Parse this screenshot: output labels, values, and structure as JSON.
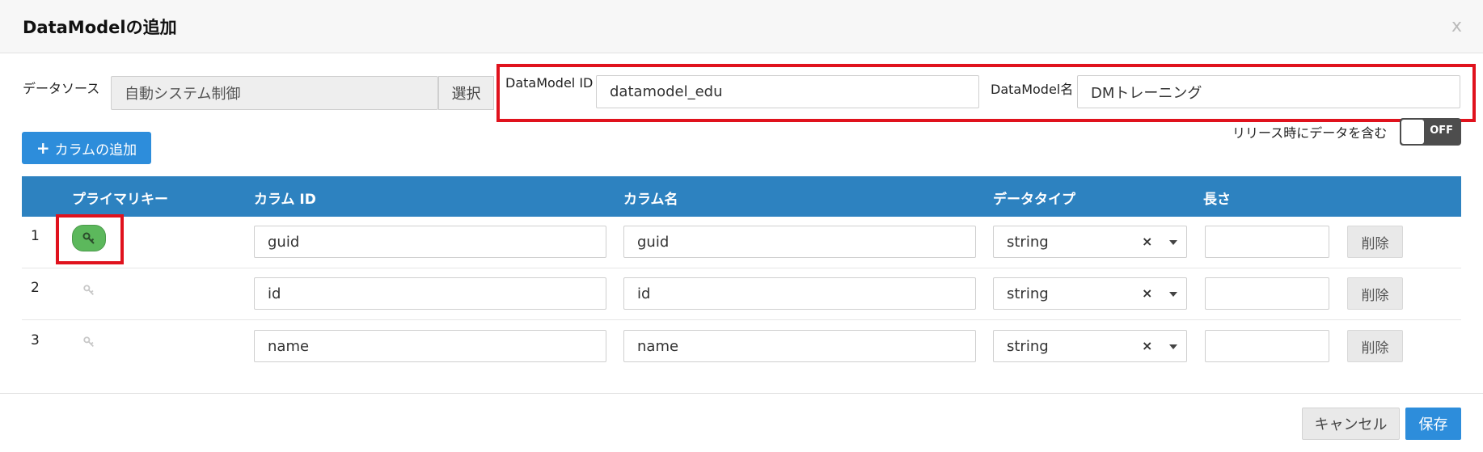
{
  "dialog": {
    "title": "DataModelの追加",
    "close_label": "x"
  },
  "datasource": {
    "label": "データソース",
    "value": "自動システム制御",
    "select_label": "選択"
  },
  "datamodel_id": {
    "label": "DataModel ID",
    "value": "datamodel_edu"
  },
  "datamodel_name": {
    "label": "DataModel名",
    "value": "DMトレーニング"
  },
  "add_column_button": {
    "icon": "plus-icon",
    "label": "カラムの追加"
  },
  "release_toggle": {
    "label": "リリース時にデータを含む",
    "state": "OFF"
  },
  "table": {
    "headers": {
      "primary_key": "プライマリキー",
      "column_id": "カラム ID",
      "column_name": "カラム名",
      "data_type": "データタイプ",
      "length": "長さ"
    },
    "rows": [
      {
        "num": "1",
        "primary_key": true,
        "column_id": "guid",
        "column_name": "guid",
        "data_type": "string",
        "length": "",
        "delete_label": "削除"
      },
      {
        "num": "2",
        "primary_key": false,
        "column_id": "id",
        "column_name": "id",
        "data_type": "string",
        "length": "",
        "delete_label": "削除"
      },
      {
        "num": "3",
        "primary_key": false,
        "column_id": "name",
        "column_name": "name",
        "data_type": "string",
        "length": "",
        "delete_label": "削除"
      }
    ],
    "clear_symbol": "×"
  },
  "footer": {
    "cancel_label": "キャンセル",
    "save_label": "保存"
  },
  "colors": {
    "accent": "#2d8ddb",
    "table_header": "#2d82c0",
    "primary_key_on": "#5cb85c",
    "highlight": "#e0121d"
  }
}
